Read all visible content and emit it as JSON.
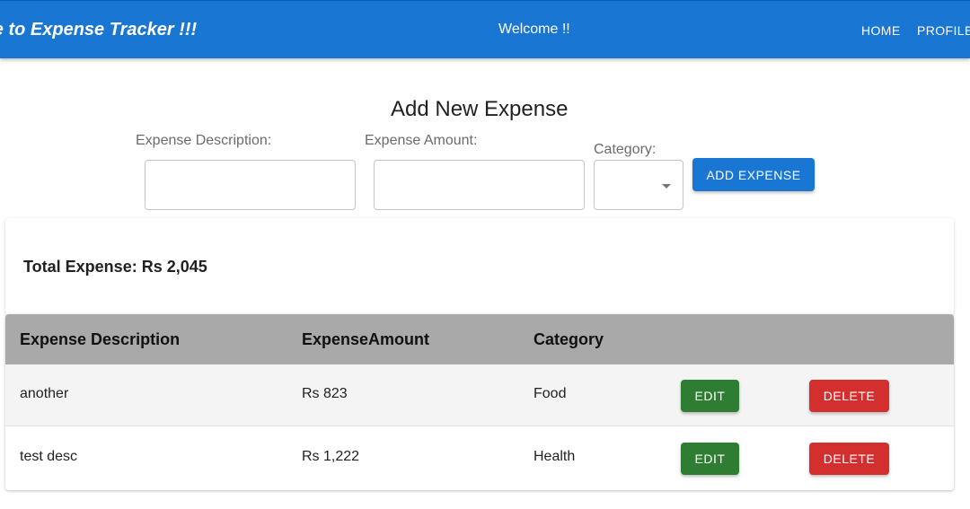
{
  "header": {
    "title": "me to Expense Tracker !!!",
    "welcome": "Welcome !!",
    "nav": {
      "home": "HOME",
      "profile": "PROFILE"
    }
  },
  "form": {
    "title": "Add New Expense",
    "description_label": "Expense Description:",
    "description_value": "",
    "amount_label": "Expense Amount:",
    "amount_value": "",
    "category_label": "Category:",
    "category_value": "",
    "add_button": "ADD EXPENSE"
  },
  "summary": {
    "total_text": "Total Expense: Rs 2,045"
  },
  "table": {
    "headers": [
      "Expense Description",
      "ExpenseAmount",
      "Category"
    ],
    "rows": [
      {
        "description": "another",
        "amount": "Rs 823",
        "category": "Food",
        "edit": "EDIT",
        "delete": "DELETE"
      },
      {
        "description": "test desc",
        "amount": "Rs 1,222",
        "category": "Health",
        "edit": "EDIT",
        "delete": "DELETE"
      }
    ]
  },
  "colors": {
    "primary": "#1976d2",
    "edit": "#2e7d32",
    "delete": "#d32f2f",
    "table_header": "#a9a9a9"
  },
  "icons": {
    "select": "chevron-down-icon"
  }
}
